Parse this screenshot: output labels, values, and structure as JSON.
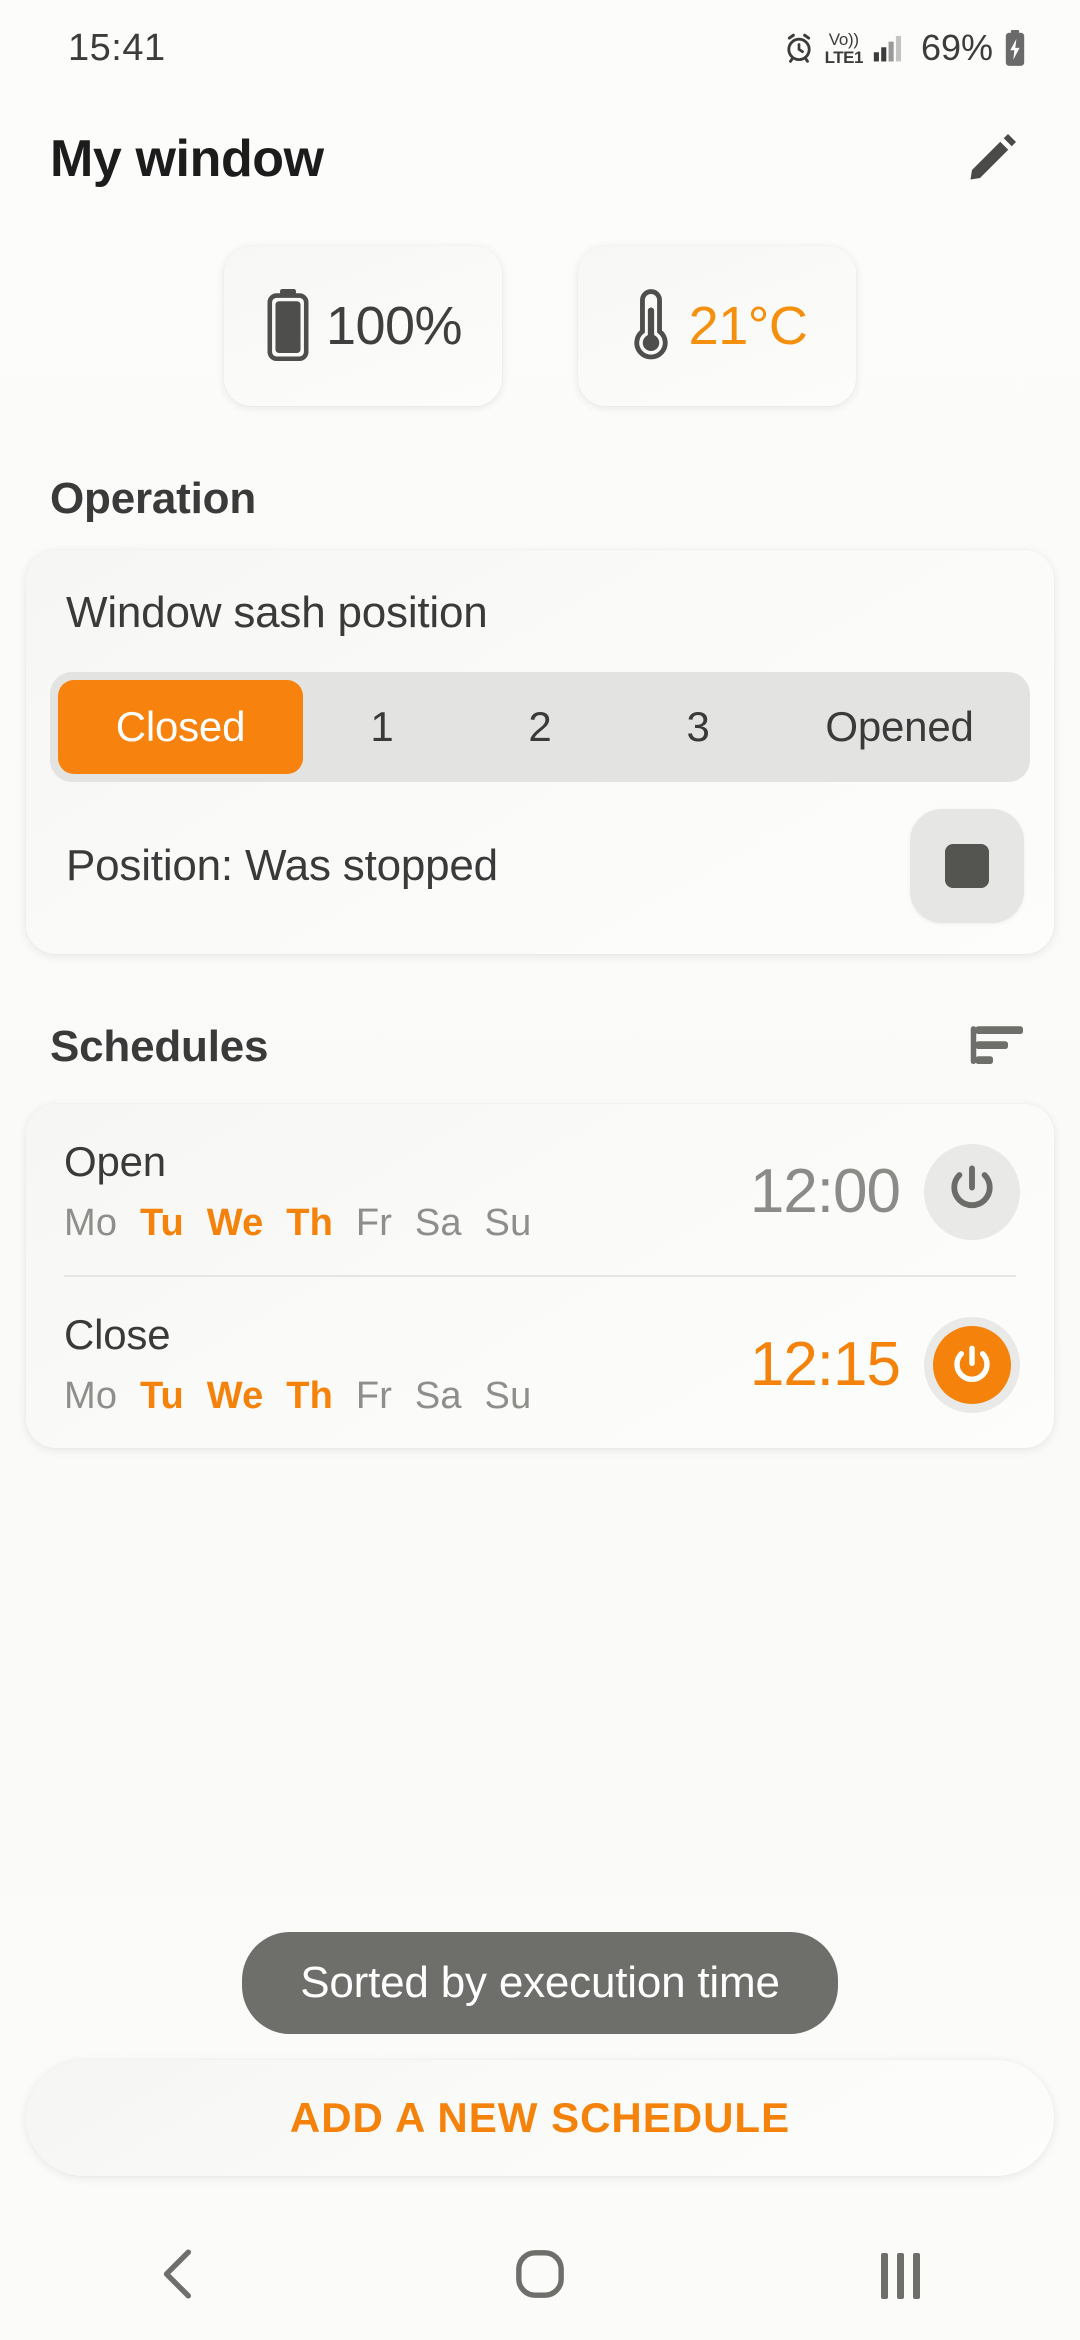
{
  "status_bar": {
    "clock": "15:41",
    "alarm_icon": "alarm-clock-icon",
    "volte_top": "Vo)）",
    "volte_line1": "Vo))",
    "volte_line2": "LTE1",
    "signal_icon": "signal-bars-icon",
    "battery_percent": "69%",
    "battery_icon": "battery-charging-icon"
  },
  "header": {
    "title": "My window",
    "edit_icon": "pencil-edit-icon"
  },
  "chips": [
    {
      "icon": "battery-full-icon",
      "value": "100%",
      "accent": false
    },
    {
      "icon": "thermometer-icon",
      "value": "21°C",
      "accent": true
    }
  ],
  "operation": {
    "section_title": "Operation",
    "sash_label": "Window sash position",
    "segments": [
      {
        "label": "Closed",
        "selected": true
      },
      {
        "label": "1",
        "selected": false
      },
      {
        "label": "2",
        "selected": false
      },
      {
        "label": "3",
        "selected": false
      },
      {
        "label": "Opened",
        "selected": false
      }
    ],
    "position_text": "Position: Was stopped",
    "stop_icon": "stop-square-icon"
  },
  "schedules": {
    "section_title": "Schedules",
    "sort_icon": "sort-lines-icon",
    "day_labels": [
      "Mo",
      "Tu",
      "We",
      "Th",
      "Fr",
      "Sa",
      "Su"
    ],
    "items": [
      {
        "name": "Open",
        "time": "12:00",
        "enabled": false,
        "active_days": [
          "Tu",
          "We",
          "Th"
        ],
        "power_icon": "power-icon"
      },
      {
        "name": "Close",
        "time": "12:15",
        "enabled": true,
        "active_days": [
          "Tu",
          "We",
          "Th"
        ],
        "power_icon": "power-icon"
      }
    ],
    "sort_chip_label": "Sorted by execution time",
    "add_button_label": "ADD A NEW SCHEDULE"
  },
  "nav_bar": {
    "back_icon": "back-chevron-icon",
    "home_icon": "home-circle-icon",
    "recents_icon": "recents-bars-icon"
  },
  "colors": {
    "accent": "#F5820B",
    "accent_text": "#F5900F",
    "text_primary": "#3a3a3a",
    "text_muted": "#8E8E8B",
    "track": "#E3E3E1",
    "page_bg": "#FBFBFA",
    "chip_dark": "#6E6E6B"
  }
}
